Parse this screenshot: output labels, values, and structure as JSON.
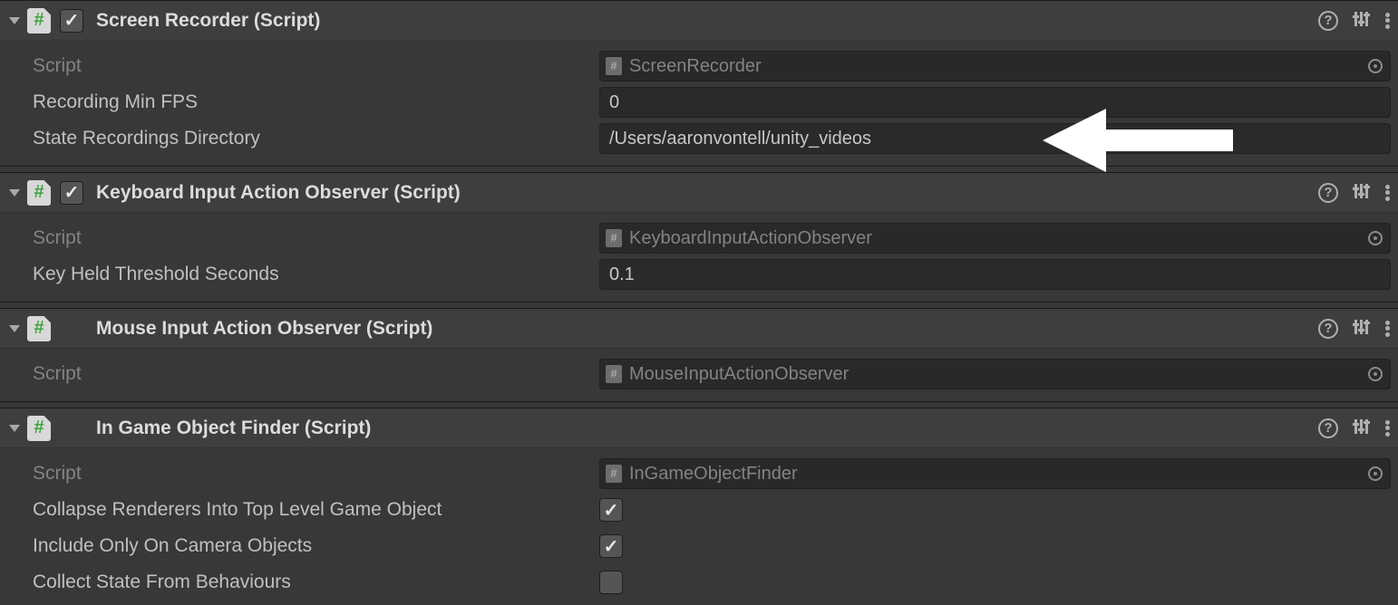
{
  "components": [
    {
      "id": "screen-recorder",
      "title": "Screen Recorder (Script)",
      "has_enable": true,
      "enabled": true,
      "props": {
        "script_label": "Script",
        "script_value": "ScreenRecorder",
        "min_fps_label": "Recording Min FPS",
        "min_fps_value": "0",
        "dir_label": "State Recordings Directory",
        "dir_value": "/Users/aaronvontell/unity_videos"
      }
    },
    {
      "id": "keyboard-observer",
      "title": "Keyboard Input Action Observer (Script)",
      "has_enable": true,
      "enabled": true,
      "props": {
        "script_label": "Script",
        "script_value": "KeyboardInputActionObserver",
        "threshold_label": "Key Held Threshold Seconds",
        "threshold_value": "0.1"
      }
    },
    {
      "id": "mouse-observer",
      "title": "Mouse Input Action Observer (Script)",
      "has_enable": false,
      "props": {
        "script_label": "Script",
        "script_value": "MouseInputActionObserver"
      }
    },
    {
      "id": "object-finder",
      "title": "In Game Object Finder (Script)",
      "has_enable": false,
      "props": {
        "script_label": "Script",
        "script_value": "InGameObjectFinder",
        "collapse_label": "Collapse Renderers Into Top Level Game Object",
        "collapse_checked": true,
        "include_label": "Include Only On Camera Objects",
        "include_checked": true,
        "collect_label": "Collect State From Behaviours",
        "collect_checked": false
      }
    }
  ]
}
